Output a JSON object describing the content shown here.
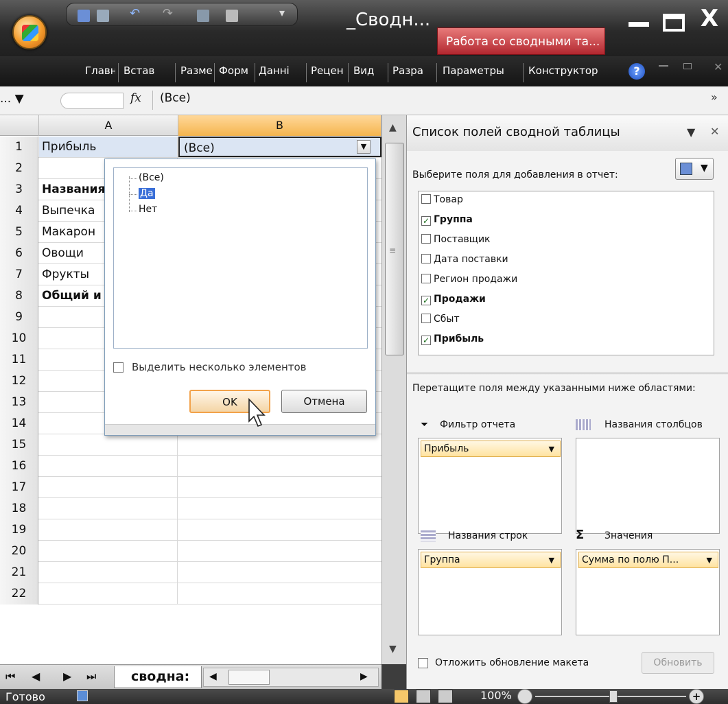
{
  "window": {
    "title": "_Сводн...",
    "context_tab": "Работа со сводными та...",
    "close_glyph": "X"
  },
  "ribbon": {
    "tabs": [
      "Главн",
      "Встав",
      "Разме",
      "Форм",
      "Данні",
      "Рецен",
      "Вид",
      "Разра",
      "Параметры",
      "Конструктор"
    ],
    "help": "?"
  },
  "formula_bar": {
    "name_box": "...",
    "fx": "fx",
    "value": "(Все)"
  },
  "grid": {
    "columns": [
      "A",
      "B"
    ],
    "rows": [
      {
        "n": "1",
        "a": "Прибыль",
        "b": "(Все)"
      },
      {
        "n": "2",
        "a": "",
        "b": ""
      },
      {
        "n": "3",
        "a": "Названия",
        "b": ""
      },
      {
        "n": "4",
        "a": "Выпечка",
        "b": ""
      },
      {
        "n": "5",
        "a": "Макарон",
        "b": ""
      },
      {
        "n": "6",
        "a": "Овощи",
        "b": ""
      },
      {
        "n": "7",
        "a": "Фрукты",
        "b": ""
      },
      {
        "n": "8",
        "a": "Общий и",
        "b": ""
      },
      {
        "n": "9"
      },
      {
        "n": "10"
      },
      {
        "n": "11"
      },
      {
        "n": "12"
      },
      {
        "n": "13"
      },
      {
        "n": "14"
      },
      {
        "n": "15"
      },
      {
        "n": "16"
      },
      {
        "n": "17"
      },
      {
        "n": "18"
      },
      {
        "n": "19"
      },
      {
        "n": "20"
      },
      {
        "n": "21"
      },
      {
        "n": "22"
      }
    ]
  },
  "filter_popup": {
    "items": [
      "(Все)",
      "Да",
      "Нет"
    ],
    "selected": "Да",
    "multi_select_label": "Выделить несколько элементов",
    "ok": "OK",
    "cancel": "Отмена"
  },
  "sheet_tab": "сводна:",
  "status": {
    "ready": "Готово",
    "zoom": "100%"
  },
  "field_list": {
    "title": "Список полей сводной таблицы",
    "choose_label": "Выберите поля для добавления в отчет:",
    "fields": [
      {
        "name": "Товар",
        "checked": false
      },
      {
        "name": "Группа",
        "checked": true
      },
      {
        "name": "Поставщик",
        "checked": false
      },
      {
        "name": "Дата поставки",
        "checked": false
      },
      {
        "name": "Регион продажи",
        "checked": false
      },
      {
        "name": "Продажи",
        "checked": true
      },
      {
        "name": "Сбыт",
        "checked": false
      },
      {
        "name": "Прибыль",
        "checked": true
      }
    ],
    "drag_label": "Перетащите поля между указанными ниже областями:",
    "report_filter": "Фильтр отчета",
    "column_labels": "Названия столбцов",
    "row_labels": "Названия строк",
    "values": "Значения",
    "filter_chip": "Прибыль",
    "row_chip": "Группа",
    "value_chip": "Сумма по полю П...",
    "defer_label": "Отложить обновление макета",
    "update_button": "Обновить"
  }
}
